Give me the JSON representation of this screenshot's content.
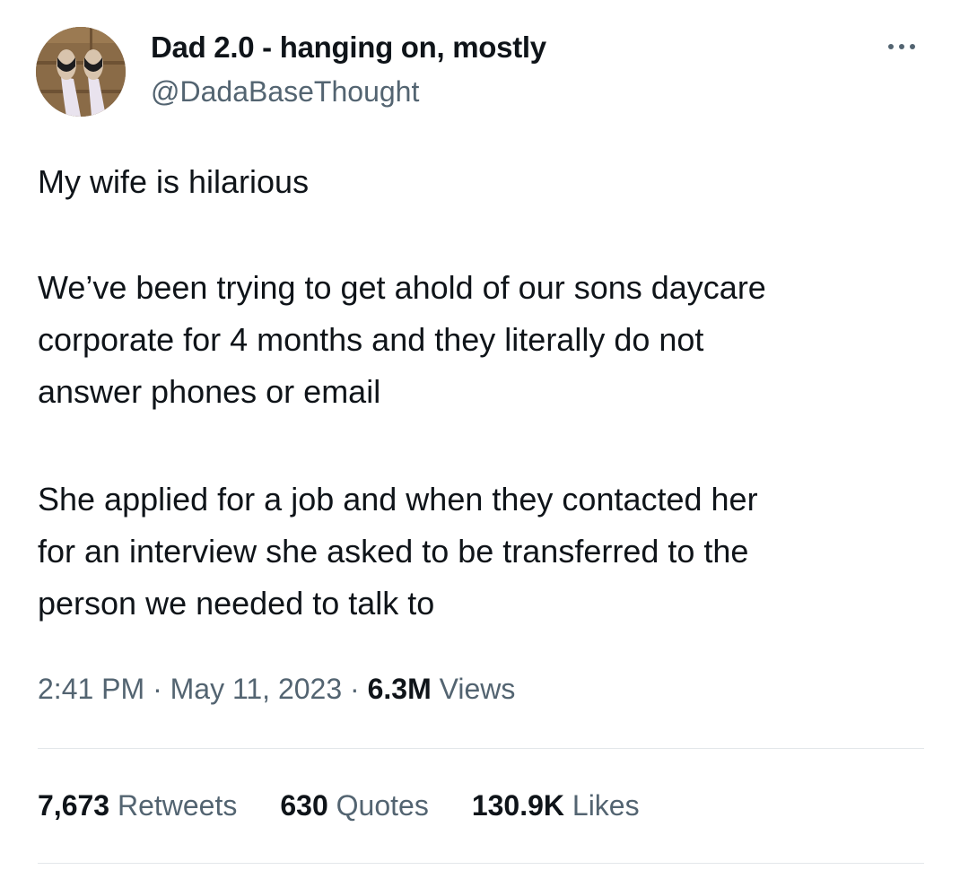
{
  "author": {
    "display_name": "Dad 2.0 - hanging on, mostly",
    "handle": "@DadaBaseThought"
  },
  "more_icon": "more-horizontal-icon",
  "tweet": {
    "paragraph1": [
      "My wife is hilarious"
    ],
    "paragraph2": [
      "We’ve been trying to get ahold of our sons daycare",
      "corporate for 4 months and they literally do not",
      "answer phones or email"
    ],
    "paragraph3": [
      "She applied for a job and when they contacted her",
      "for an interview she asked to be transferred to the",
      "person we needed to talk to"
    ]
  },
  "meta": {
    "time": "2:41 PM",
    "separator": "·",
    "date": "May 11, 2023",
    "views_count": "6.3M",
    "views_label": "Views"
  },
  "stats": {
    "retweets_count": "7,673",
    "retweets_label": "Retweets",
    "quotes_count": "630",
    "quotes_label": "Quotes",
    "likes_count": "130.9K",
    "likes_label": "Likes"
  },
  "colors": {
    "text_primary": "#0f1419",
    "text_secondary": "#536471",
    "divider": "#e3e7ea",
    "background": "#ffffff"
  }
}
